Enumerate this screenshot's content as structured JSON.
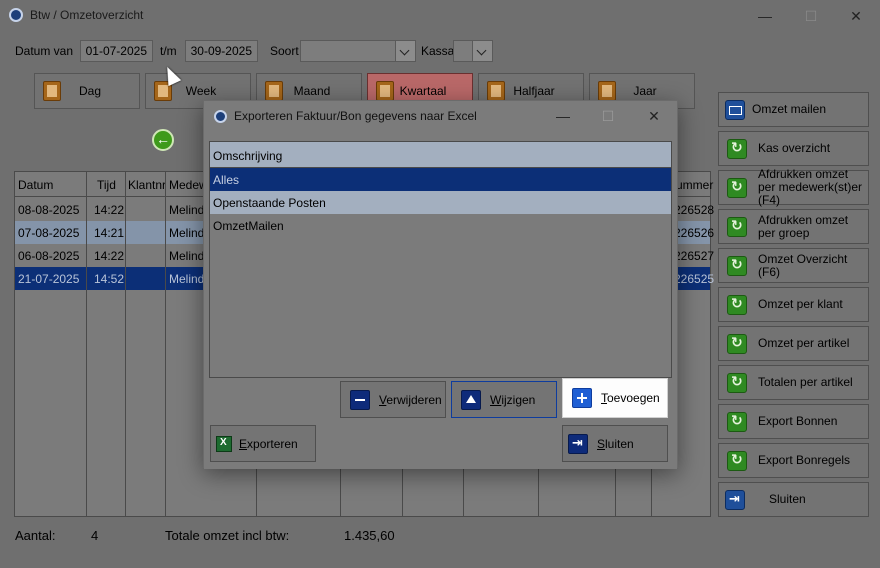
{
  "window": {
    "title": "Btw / Omzetoverzicht"
  },
  "filters": {
    "datum_van_label": "Datum van",
    "datum_van": "01-07-2025",
    "tm_label": "t/m",
    "datum_tm": "30-09-2025",
    "soort_label": "Soort",
    "soort_value": "",
    "kassa_label": "Kassa",
    "kassa_value": ""
  },
  "periods": [
    {
      "label": "Dag",
      "active": false
    },
    {
      "label": "Week",
      "active": false
    },
    {
      "label": "Maand",
      "active": false
    },
    {
      "label": "Kwartaal",
      "active": true
    },
    {
      "label": "Halfjaar",
      "active": false
    },
    {
      "label": "Jaar",
      "active": false
    }
  ],
  "grid": {
    "columns": [
      "Datum",
      "Tijd",
      "Klantnr",
      "Medew",
      "ummer"
    ],
    "rows": [
      {
        "datum": "08-08-2025",
        "tijd": "14:22",
        "klantnr": "",
        "medew": "Melinda",
        "nummer": "226528",
        "style": "normal"
      },
      {
        "datum": "07-08-2025",
        "tijd": "14:21",
        "klantnr": "",
        "medew": "Melinda",
        "nummer": "226526",
        "style": "alt"
      },
      {
        "datum": "06-08-2025",
        "tijd": "14:22",
        "klantnr": "",
        "medew": "Melinda",
        "nummer": "226527",
        "style": "normal"
      },
      {
        "datum": "21-07-2025",
        "tijd": "14:52",
        "klantnr": "",
        "medew": "Melinda",
        "nummer": "226525",
        "style": "sel"
      }
    ]
  },
  "side_buttons": [
    {
      "label": "Omzet mailen",
      "icon": "mail-icon"
    },
    {
      "label": "Kas overzicht",
      "icon": "refresh-icon"
    },
    {
      "label": "Afdrukken omzet per medewerk(st)er (F4)",
      "icon": "refresh-icon"
    },
    {
      "label": "Afdrukken omzet per groep",
      "icon": "refresh-icon"
    },
    {
      "label": "Omzet Overzicht (F6)",
      "icon": "refresh-icon"
    },
    {
      "label": "Omzet per klant",
      "icon": "refresh-icon"
    },
    {
      "label": "Omzet per artikel",
      "icon": "refresh-icon"
    },
    {
      "label": "Totalen per artikel",
      "icon": "refresh-icon"
    },
    {
      "label": "Export Bonnen",
      "icon": "refresh-icon"
    },
    {
      "label": "Export Bonregels",
      "icon": "refresh-icon"
    },
    {
      "label": "Sluiten",
      "icon": "exit-icon"
    }
  ],
  "footer": {
    "aantal_label": "Aantal:",
    "aantal_value": "4",
    "totaal_label": "Totale omzet incl btw:",
    "totaal_value": "1.435,60"
  },
  "dialog": {
    "title": "Exporteren Faktuur/Bon gegevens naar Excel",
    "list_header": "Omschrijving",
    "items": [
      {
        "label": "Alles",
        "style": "sel"
      },
      {
        "label": "Openstaande Posten",
        "style": "alt"
      },
      {
        "label": "OmzetMailen",
        "style": "normal"
      }
    ],
    "verwijderen_rest": "erwijderen",
    "verwijderen_key": "V",
    "wijzigen_rest": "ijzigen",
    "wijzigen_key": "W",
    "toevoegen_rest": "oevoegen",
    "toevoegen_key": "T",
    "exporteren_rest": "xporteren",
    "exporteren_key": "E",
    "sluiten_rest": "luiten",
    "sluiten_key": "S"
  }
}
